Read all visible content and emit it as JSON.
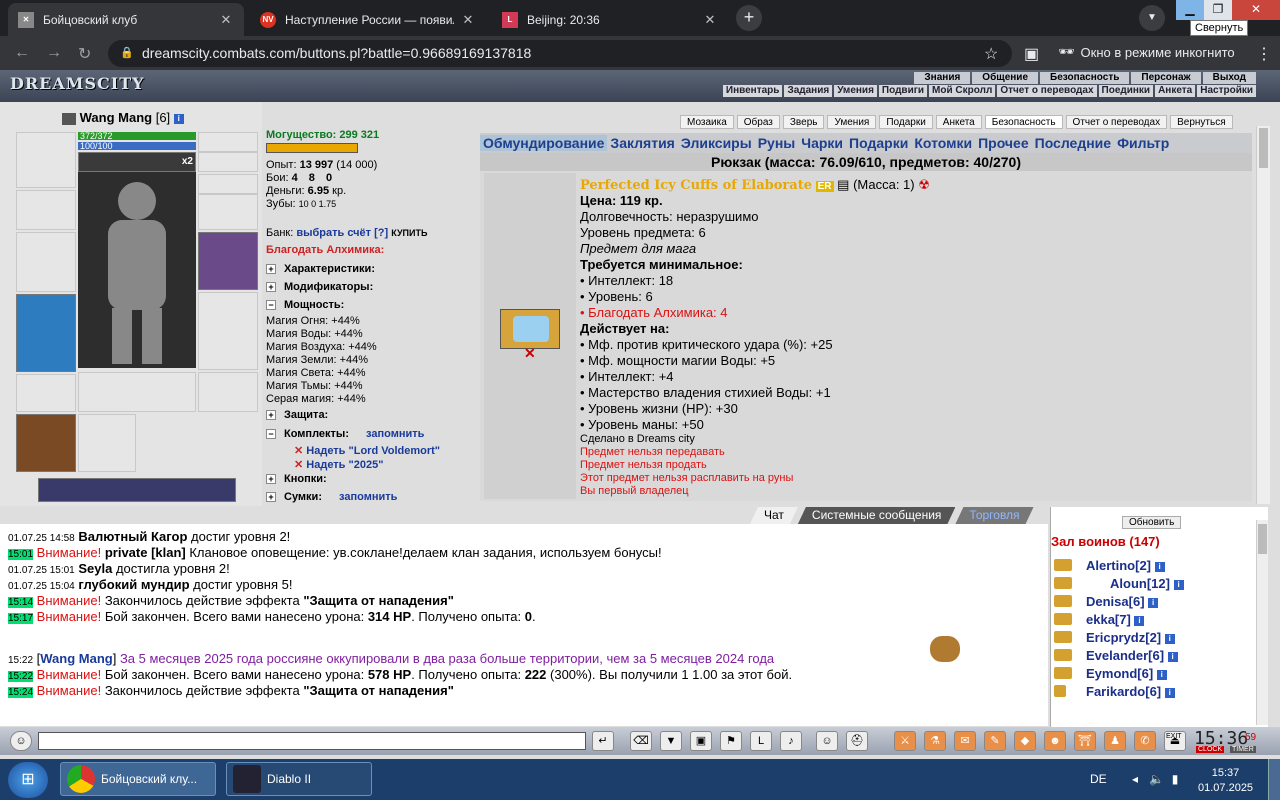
{
  "browser": {
    "tabs": [
      {
        "title": "Бойцовский клуб",
        "favicon": "fc-icon"
      },
      {
        "title": "Наступление России — появил",
        "favicon": "NV"
      },
      {
        "title": "Beijing: 20:36",
        "favicon": "L"
      }
    ],
    "tooltip": "Свернуть",
    "url": "dreamscity.combats.com/buttons.pl?battle=0.96689169137818",
    "incognito_label": "Окно в режиме инкогнито"
  },
  "header": {
    "logo": "DREAMSCITY",
    "menu_top": [
      "Знания",
      "Общение",
      "Безопасность",
      "Персонаж",
      "Выход"
    ],
    "menu_bottom": [
      "Инвентарь",
      "Задания",
      "Умения",
      "Подвиги",
      "Мой Скролл",
      "Отчет о переводах",
      "Поединки",
      "Анкета",
      "Настройки"
    ]
  },
  "character": {
    "name": "Wang Mang",
    "level": "[6]",
    "hp": "372/372",
    "mp": "100/100",
    "buff_count": "x2",
    "power": "Могущество: 299 321",
    "exp_label": "Опыт:",
    "exp_value": "13 997",
    "exp_next": "(14 000)",
    "fights_label": "Бои:",
    "fights_win": "4",
    "fights_loss": "8",
    "fights_draw": "0",
    "money_label": "Деньги:",
    "money_value": "6.95",
    "money_unit": "кр.",
    "teeth_label": "Зубы:",
    "teeth_values": "10  0  1.75",
    "bank_label": "Банк:",
    "bank_link": "выбрать счёт",
    "bank_help": "[?]",
    "bank_buy": "КУПИТЬ",
    "alchemist": "Благодать Алхимика:"
  },
  "sections": {
    "chars": "Характеристики:",
    "mods": "Модификаторы:",
    "power": "Мощность:",
    "defense": "Защита:",
    "sets": "Комплекты:",
    "sets_link": "запомнить",
    "set1": "Надеть \"Lord Voldemort\"",
    "set2": "Надеть \"2025\"",
    "buttons": "Кнопки:",
    "bags": "Сумки:",
    "bags_link": "запомнить"
  },
  "magic": [
    "Магия Огня: +44%",
    "Магия Воды: +44%",
    "Магия Воздуха: +44%",
    "Магия Земли: +44%",
    "Магия Света: +44%",
    "Магия Тьмы: +44%",
    "Серая магия: +44%"
  ],
  "top_tabs": [
    "Мозаика",
    "Образ",
    "Зверь",
    "Умения",
    "Подарки",
    "Анкета",
    "Безопасность",
    "Отчет о переводах",
    "Вернуться"
  ],
  "categories": [
    "Обмундирование",
    "Заклятия",
    "Эликсиры",
    "Руны",
    "Чарки",
    "Подарки",
    "Котомки",
    "Прочее",
    "Последние",
    "Фильтр"
  ],
  "backpack": "Рюкзак (масса: 76.09/610, предметов: 40/270)",
  "item": {
    "name": "Perfected Icy Cuffs of Elaborate",
    "badge": "ER",
    "mass": "(Масса: 1)",
    "price": "Цена: 119 кр.",
    "durability": "Долговечность: неразрушимо",
    "level": "Уровень предмета: 6",
    "for": "Предмет для мага",
    "req_title": "Требуется минимальное:",
    "req": [
      "• Интеллект: 18",
      "• Уровень: 6"
    ],
    "req_red": "• Благодать Алхимика: 4",
    "acts_title": "Действует на:",
    "acts": [
      "• Мф. против критического удара (%): +25",
      "• Мф. мощности магии Воды: +5",
      "• Интеллект: +4",
      "• Мастерство владения стихией Воды: +1",
      "• Уровень жизни (HP): +30",
      "• Уровень маны: +50"
    ],
    "made": "Сделано в Dreams city",
    "notes": [
      "Предмет нельзя передавать",
      "Предмет нельзя продать",
      "Этот предмет нельзя расплавить на руны",
      "Вы первый владелец"
    ]
  },
  "chat_tabs": [
    "Чат",
    "Системные сообщения",
    "Торговля"
  ],
  "chat": [
    {
      "ts": "01.07.25 14:58",
      "g": false,
      "who": "Валютный Кагор",
      "text": " достиг уровня 2!"
    },
    {
      "ts": "15:01",
      "g": true,
      "warn": "Внимание!",
      "who": " private [klan]",
      "text": " Клановое оповещение: ув.соклане!делаем клан задания, используем бонусы!"
    },
    {
      "ts": "01.07.25 15:01",
      "g": false,
      "who": "Seyla",
      "text": " достигла уровня 2!"
    },
    {
      "ts": "01.07.25 15:04",
      "g": false,
      "who": "глубокий мундир",
      "text": " достиг уровня 5!"
    },
    {
      "ts": "15:14",
      "g": true,
      "warn": "Внимание!",
      "text": " Закончилось действие эффекта ",
      "bold": "\"Защита от нападения\""
    },
    {
      "ts": "15:17",
      "g": true,
      "warn": "Внимание!",
      "text": " Бой закончен. Всего вами нанесено урона: ",
      "bold": "314 HP",
      "tail": ". Получено опыта: ",
      "bold2": "0",
      "tail2": "."
    },
    {
      "ts": "15:22",
      "g": false,
      "who": "Wang Mang",
      "purple": " За 5 месяцев 2025 года россияне оккупировали в два раза больше территории, чем за 5 месяцев 2024 года"
    },
    {
      "ts": "15:22",
      "g": true,
      "warn": "Внимание!",
      "text": " Бой закончен. Всего вами нанесено урона: ",
      "bold": "578 HP",
      "tail": ". Получено опыта: ",
      "bold2": "222",
      "tail2": " (300%). Вы получили  1  1.00 за этот бой."
    },
    {
      "ts": "15:24",
      "g": true,
      "warn": "Внимание!",
      "text": " Закончилось действие эффекта ",
      "bold": "\"Защита от нападения\""
    }
  ],
  "room": {
    "refresh": "Обновить",
    "title": "Зал воинов (147)",
    "players": [
      "Alertino[2]",
      "Aloun[12]",
      "Denisa[6]",
      "ekka[7]",
      "Ericprydz[2]",
      "Evelander[6]",
      "Eymond[6]",
      "Farikardo[6]"
    ]
  },
  "bottom": {
    "clock": "15:36",
    "clock_sec": "59",
    "clock_label": "CLOCK",
    "timer_label": "TIMER",
    "exit_label": "EXIT"
  },
  "taskbar": {
    "apps": [
      "Бойцовский клу...",
      "Diablo II"
    ],
    "lang": "DE",
    "time": "15:37",
    "date": "01.07.2025"
  }
}
